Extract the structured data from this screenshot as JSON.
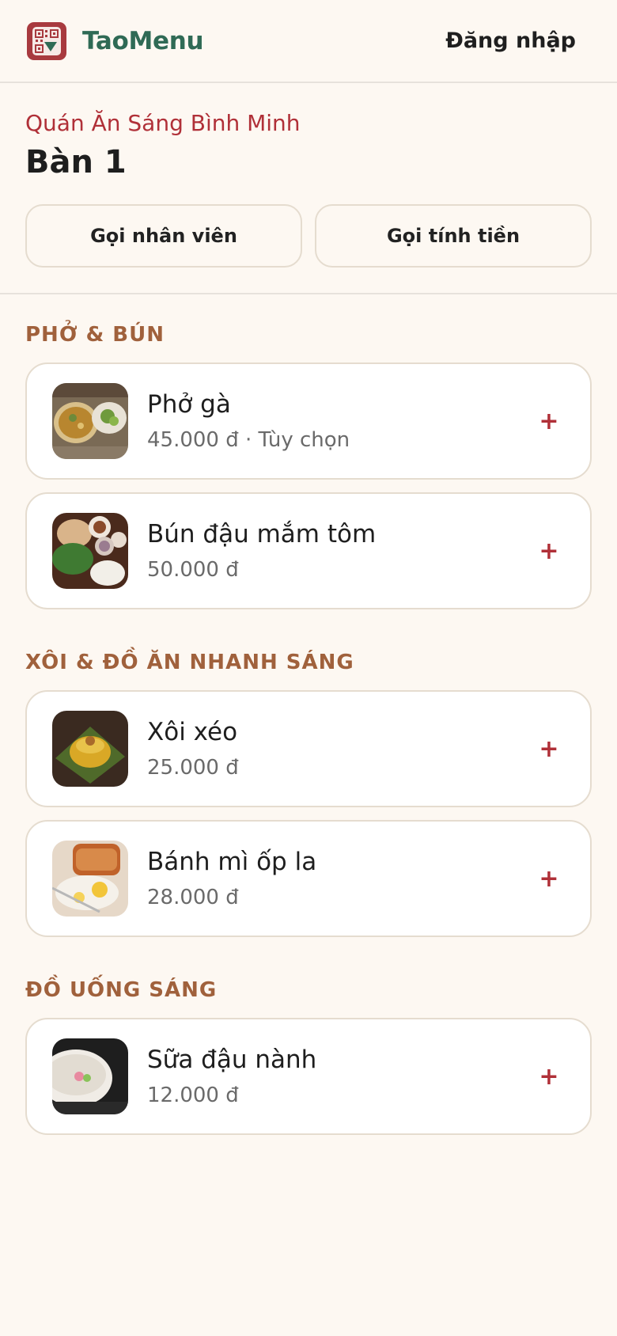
{
  "header": {
    "brand_name": "TaoMenu",
    "login_label": "Đăng nhập"
  },
  "venue": {
    "name": "Quán Ăn Sáng Bình Minh",
    "table": "Bàn 1",
    "call_staff_label": "Gọi nhân viên",
    "call_bill_label": "Gọi tính tiền"
  },
  "menu": {
    "categories": [
      {
        "title": "PHỞ & BÚN",
        "items": [
          {
            "name": "Phở gà",
            "price": "45.000 đ · Tùy chọn",
            "add": "+"
          },
          {
            "name": "Bún đậu mắm tôm",
            "price": "50.000 đ",
            "add": "+"
          }
        ]
      },
      {
        "title": "XÔI & ĐỒ ĂN NHANH SÁNG",
        "items": [
          {
            "name": "Xôi xéo",
            "price": "25.000 đ",
            "add": "+"
          },
          {
            "name": "Bánh mì ốp la",
            "price": "28.000 đ",
            "add": "+"
          }
        ]
      },
      {
        "title": "ĐỒ UỐNG SÁNG",
        "items": [
          {
            "name": "Sữa đậu nành",
            "price": "12.000 đ",
            "add": "+"
          }
        ]
      }
    ]
  },
  "colors": {
    "background": "#fdf8f2",
    "brand": "#2f6a55",
    "accent": "#b03038",
    "category": "#a0613c",
    "logo": "#a83a3f"
  },
  "icons": {
    "logo": "qr-menu-logo-icon",
    "add": "plus-icon"
  }
}
